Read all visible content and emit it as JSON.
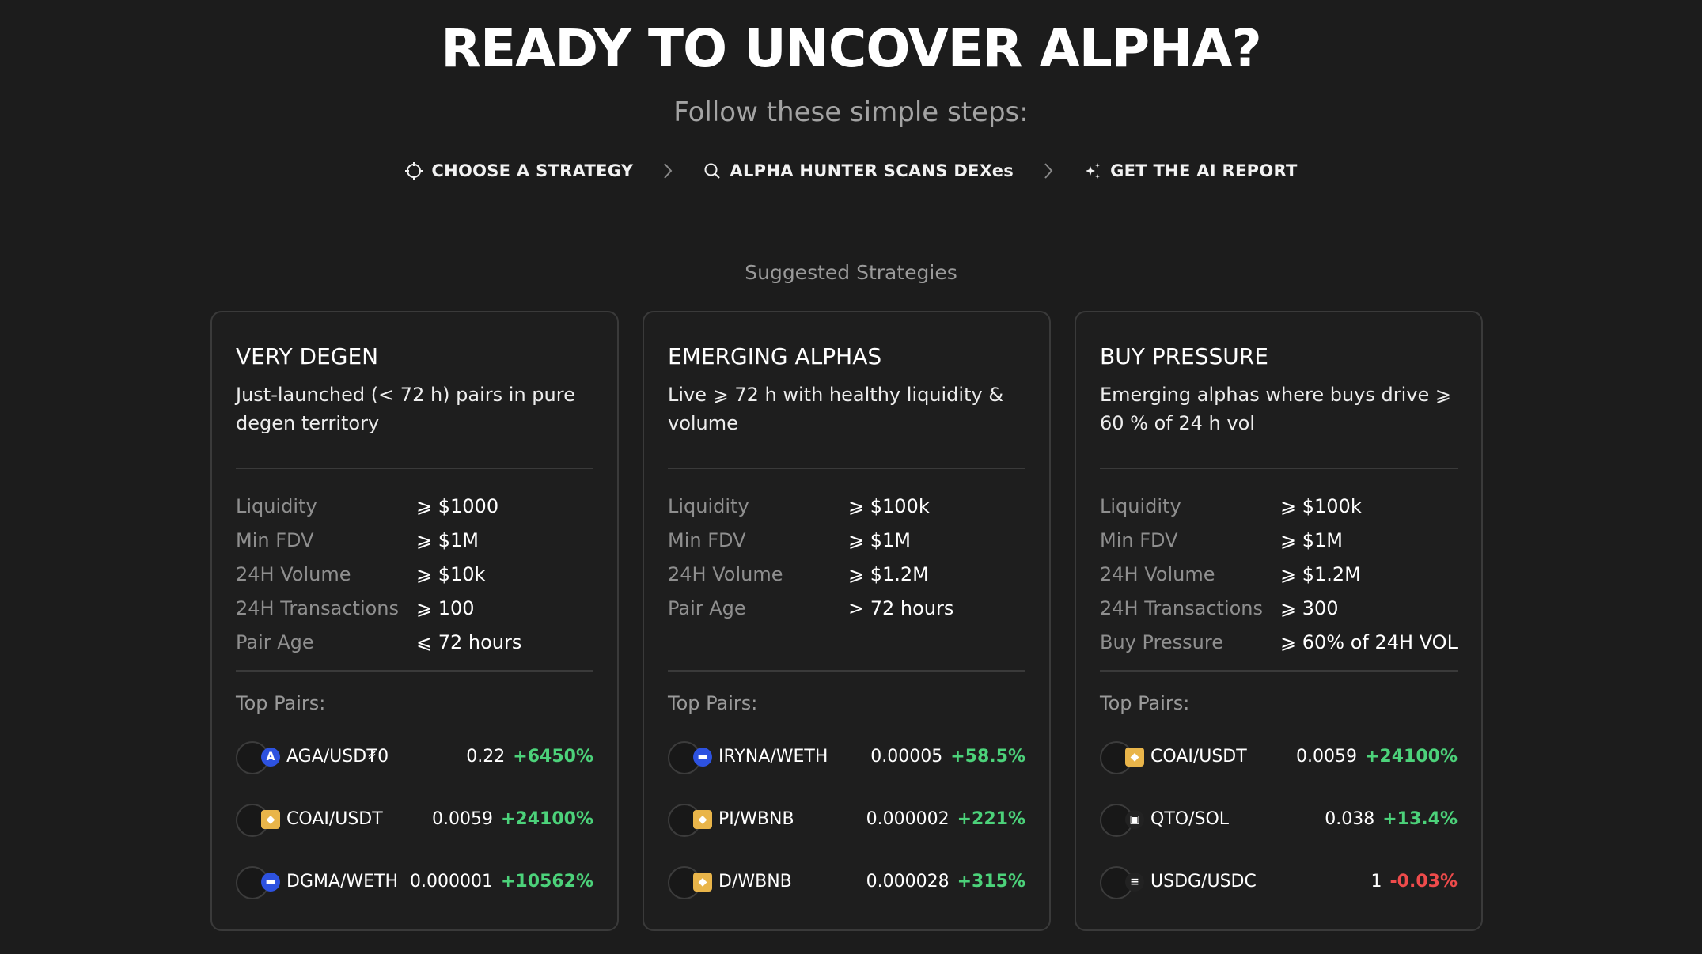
{
  "hero": {
    "title": "READY TO UNCOVER ALPHA?",
    "subtitle": "Follow these simple steps:"
  },
  "steps": [
    {
      "label": "CHOOSE A STRATEGY",
      "icon": "crosshair-icon"
    },
    {
      "label": "ALPHA HUNTER SCANS DEXes",
      "icon": "search-icon"
    },
    {
      "label": "GET THE AI REPORT",
      "icon": "sparkle-icon"
    }
  ],
  "section_label": "Suggested Strategies",
  "colors": {
    "background": "#1c1c1c",
    "positive": "#4cd27a",
    "negative": "#ef4b4b",
    "muted": "#8f8f8f"
  },
  "cards": [
    {
      "title": "VERY DEGEN",
      "description": "Just-launched (< 72 h) pairs in pure degen territory",
      "criteria": [
        {
          "key": "Liquidity",
          "value": "⩾ $1000"
        },
        {
          "key": "Min FDV",
          "value": "⩾ $1M"
        },
        {
          "key": "24H Volume",
          "value": "⩾ $10k"
        },
        {
          "key": "24H Transactions",
          "value": "⩾ 100"
        },
        {
          "key": "Pair Age",
          "value": "⩽ 72 hours"
        }
      ],
      "top_label": "Top Pairs:",
      "pairs": [
        {
          "name": "AGA/USD₮0",
          "price": "0.22",
          "change": "+6450%",
          "icon": "aga-token-icon",
          "token_style": "blue",
          "glyph": "A"
        },
        {
          "name": "COAI/USDT",
          "price": "0.0059",
          "change": "+24100%",
          "icon": "bnb-token-icon",
          "token_style": "gold",
          "glyph": "◆"
        },
        {
          "name": "DGMA/WETH",
          "price": "0.000001",
          "change": "+10562%",
          "icon": "base-token-icon",
          "token_style": "blue",
          "glyph": "▬"
        }
      ]
    },
    {
      "title": "EMERGING ALPHAS",
      "description": "Live ⩾ 72 h with healthy liquidity & volume",
      "criteria": [
        {
          "key": "Liquidity",
          "value": "⩾ $100k"
        },
        {
          "key": "Min FDV",
          "value": "⩾ $1M"
        },
        {
          "key": "24H Volume",
          "value": "⩾ $1.2M"
        },
        {
          "key": "Pair Age",
          "value": "> 72 hours"
        }
      ],
      "top_label": "Top Pairs:",
      "pairs": [
        {
          "name": "IRYNA/WETH",
          "price": "0.00005",
          "change": "+58.5%",
          "icon": "base-token-icon",
          "token_style": "blue",
          "glyph": "▬"
        },
        {
          "name": "PI/WBNB",
          "price": "0.000002",
          "change": "+221%",
          "icon": "bnb-token-icon",
          "token_style": "gold",
          "glyph": "◆"
        },
        {
          "name": "D/WBNB",
          "price": "0.000028",
          "change": "+315%",
          "icon": "bnb-token-icon",
          "token_style": "gold",
          "glyph": "◆"
        }
      ]
    },
    {
      "title": "BUY PRESSURE",
      "description": "Emerging alphas where buys drive ⩾ 60 % of 24 h vol",
      "criteria": [
        {
          "key": "Liquidity",
          "value": "⩾ $100k"
        },
        {
          "key": "Min FDV",
          "value": "⩾ $1M"
        },
        {
          "key": "24H Volume",
          "value": "⩾ $1.2M"
        },
        {
          "key": "24H Transactions",
          "value": "⩾ 300"
        },
        {
          "key": "Buy Pressure",
          "value": "⩾ 60% of 24H VOL"
        }
      ],
      "top_label": "Top Pairs:",
      "pairs": [
        {
          "name": "COAI/USDT",
          "price": "0.0059",
          "change": "+24100%",
          "icon": "bnb-token-icon",
          "token_style": "gold",
          "glyph": "◆"
        },
        {
          "name": "QTO/SOL",
          "price": "0.038",
          "change": "+13.4%",
          "icon": "qto-token-icon",
          "token_style": "dark",
          "glyph": "▣"
        },
        {
          "name": "USDG/USDC",
          "price": "1",
          "change": "-0.03%",
          "icon": "solana-token-icon",
          "token_style": "dark",
          "glyph": "≡"
        }
      ]
    }
  ]
}
